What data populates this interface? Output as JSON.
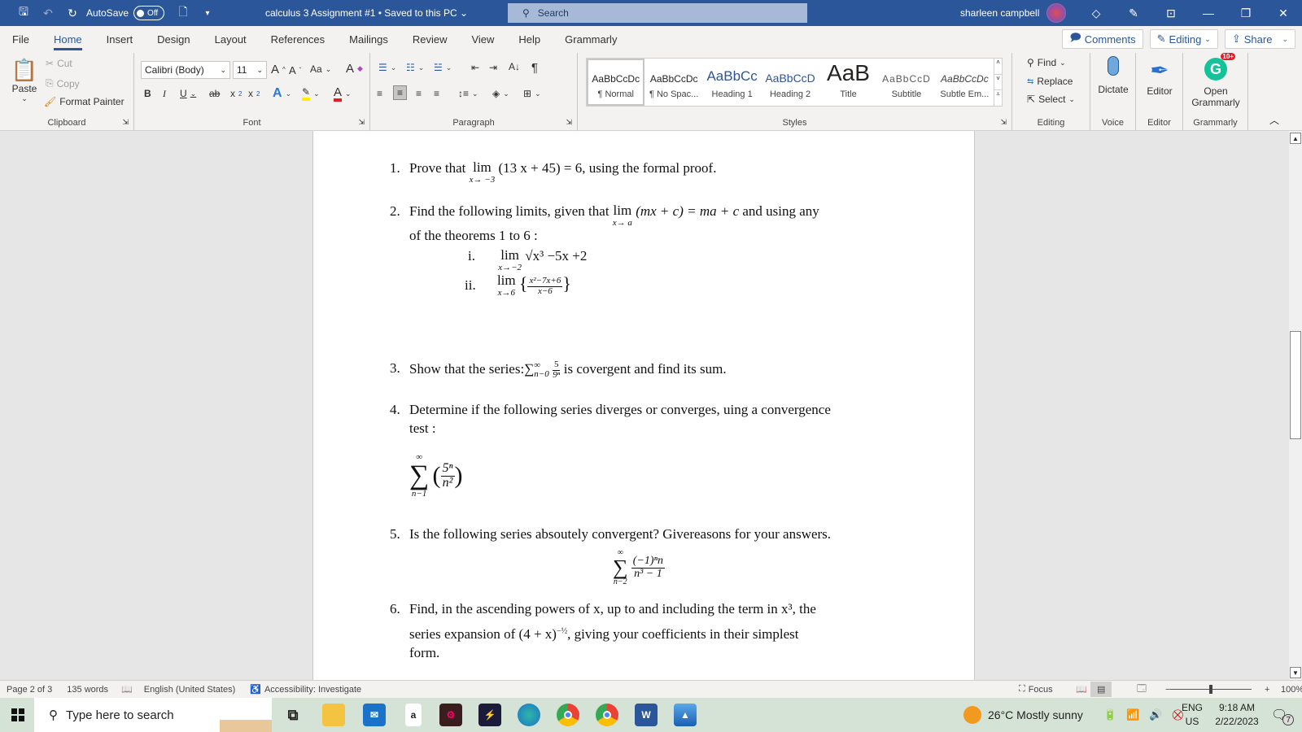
{
  "titlebar": {
    "autosave_label": "AutoSave",
    "autosave_state": "Off",
    "doc_title": "calculus 3 Assignment #1",
    "save_status": "Saved to this PC",
    "search_placeholder": "Search",
    "user_name": "sharleen campbell"
  },
  "menu": {
    "tabs": [
      "File",
      "Home",
      "Insert",
      "Design",
      "Layout",
      "References",
      "Mailings",
      "Review",
      "View",
      "Help",
      "Grammarly"
    ],
    "active": "Home",
    "comments": "Comments",
    "editing": "Editing",
    "share": "Share"
  },
  "ribbon": {
    "clipboard": {
      "label": "Clipboard",
      "paste": "Paste",
      "cut": "Cut",
      "copy": "Copy",
      "format_painter": "Format Painter"
    },
    "font": {
      "label": "Font",
      "family": "Calibri (Body)",
      "size": "11",
      "change_case": "Aa"
    },
    "paragraph": {
      "label": "Paragraph"
    },
    "styles": {
      "label": "Styles",
      "items": [
        {
          "preview": "AaBbCcDc",
          "name": "¶ Normal"
        },
        {
          "preview": "AaBbCcDc",
          "name": "¶ No Spac..."
        },
        {
          "preview": "AaBbCc",
          "name": "Heading 1"
        },
        {
          "preview": "AaBbCcD",
          "name": "Heading 2"
        },
        {
          "preview": "AaB",
          "name": "Title"
        },
        {
          "preview": "AaBbCcD",
          "name": "Subtitle"
        },
        {
          "preview": "AaBbCcDc",
          "name": "Subtle Em..."
        }
      ]
    },
    "editing": {
      "label": "Editing",
      "find": "Find",
      "replace": "Replace",
      "select": "Select"
    },
    "voice": {
      "label": "Voice",
      "dictate": "Dictate"
    },
    "editor": {
      "label": "Editor",
      "editor": "Editor"
    },
    "grammarly": {
      "label": "Grammarly",
      "open": "Open Grammarly",
      "badge": "10+"
    }
  },
  "document": {
    "q1": {
      "num": "1.",
      "pre": "Prove that",
      "lim_sub": "x→ −3",
      "expr": "(13 x + 45) = 6",
      "post": ", using the formal proof."
    },
    "q2": {
      "num": "2.",
      "pre": "Find the following limits, given that",
      "lim_sub": "x→ a",
      "expr": "(mx + c) = ma + c",
      "post": "and using any",
      "line2": "of the theorems 1 to 6 :",
      "i": {
        "label": "i.",
        "lim_sub": "x→−2",
        "expr": "√x³ −5x +2"
      },
      "ii": {
        "label": "ii.",
        "lim_sub": "x→6",
        "numer": "x²−7x+6",
        "denom": "x−6"
      }
    },
    "q3": {
      "num": "3.",
      "pre": "Show that the series:∑",
      "sup": "∞",
      "sub": "n−0",
      "numer": "5",
      "denom": "9ⁿ",
      "post": "is covergent and find its sum."
    },
    "q4": {
      "num": "4.",
      "line1": "Determine if the following series diverges or converges, uing a convergence",
      "line2": "test :",
      "sum_top": "∞",
      "sum_bot": "n−1",
      "numer": "5ⁿ",
      "denom": "n²"
    },
    "q5": {
      "num": "5.",
      "text": "Is the following series absoutely convergent? Givereasons for your answers.",
      "sum_top": "∞",
      "sum_bot": "n−2",
      "numer": "(−1)ⁿn",
      "denom": "n³ − 1"
    },
    "q6": {
      "num": "6.",
      "line1": "Find, in the ascending powers of x, up to and including the term in x³, the",
      "line2a": "series expansion of (4 + x)",
      "exp": "−½",
      "line2b": ", giving your coefficients in their simplest",
      "line3": "form."
    }
  },
  "statusbar": {
    "page": "Page 2 of 3",
    "words": "135 words",
    "language": "English (United States)",
    "accessibility": "Accessibility: Investigate",
    "focus": "Focus",
    "zoom": "100%"
  },
  "taskbar": {
    "search_placeholder": "Type here to search",
    "weather": "26°C  Mostly sunny",
    "lang1": "ENG",
    "lang2": "US",
    "time": "9:18 AM",
    "date": "2/22/2023",
    "notifications": "7"
  }
}
